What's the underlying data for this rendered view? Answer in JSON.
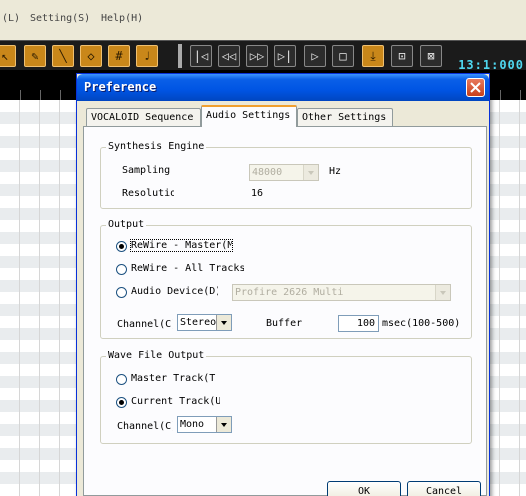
{
  "app": {
    "menu": [
      "(L)",
      "Setting(S)",
      "Help(H)"
    ],
    "timecode": "13:1:000"
  },
  "dialog": {
    "title": "Preference",
    "tabs": [
      "VOCALOID Sequence",
      "Audio Settings",
      "Other Settings"
    ],
    "active_tab": "Audio Settings",
    "synthesis": {
      "title": "Synthesis Engine",
      "sampling_label": "Sampling",
      "sampling_value": "48000",
      "sampling_unit": "Hz",
      "resolution_label": "Resolution",
      "resolution_value": "16"
    },
    "output": {
      "title": "Output",
      "radio_master": "ReWire - Master(M)",
      "radio_all": "ReWire - All Tracks",
      "radio_device": "Audio Device(D)",
      "device_value": "Profire 2626 Multi",
      "channel_label": "Channel(C)",
      "channel_value": "Stereo",
      "buffer_label": "Buffer",
      "buffer_value": "100",
      "buffer_unit": "msec(100-500)",
      "selected": "ReWire - Master(M)"
    },
    "wave": {
      "title": "Wave File Output",
      "radio_master": "Master Track(T)",
      "radio_current": "Current Track(U)",
      "channel_label": "Channel(C)",
      "channel_value": "Mono",
      "selected": "Current Track(U)"
    },
    "ok_label": "OK",
    "cancel_label": "Cancel"
  }
}
